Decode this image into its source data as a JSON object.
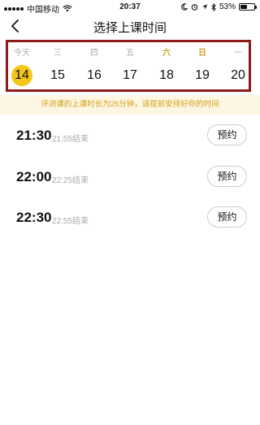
{
  "status_bar": {
    "carrier": "中国移动",
    "time": "20:37",
    "battery": "53%",
    "battery_level": 0.53
  },
  "nav": {
    "title": "选择上课时间",
    "back_icon": "chevron-left-icon"
  },
  "week": {
    "selected_index": 0,
    "days": [
      {
        "weekday": "今天",
        "date": "14",
        "weekend": false
      },
      {
        "weekday": "三",
        "date": "15",
        "weekend": false
      },
      {
        "weekday": "四",
        "date": "16",
        "weekend": false
      },
      {
        "weekday": "五",
        "date": "17",
        "weekend": false
      },
      {
        "weekday": "六",
        "date": "18",
        "weekend": true
      },
      {
        "weekday": "日",
        "date": "19",
        "weekend": true
      },
      {
        "weekday": "一",
        "date": "20",
        "weekend": false
      }
    ],
    "accent_color": "#f5c518",
    "highlight_border_color": "#8b1a1a"
  },
  "notice": {
    "text": "评测课的上课时长为25分钟，请提前安排好你的时间"
  },
  "slots": [
    {
      "time": "21:30",
      "end": "21:55结束",
      "button": "预约"
    },
    {
      "time": "22:00",
      "end": "22:25结束",
      "button": "预约"
    },
    {
      "time": "22:30",
      "end": "22:55结束",
      "button": "预约"
    }
  ]
}
